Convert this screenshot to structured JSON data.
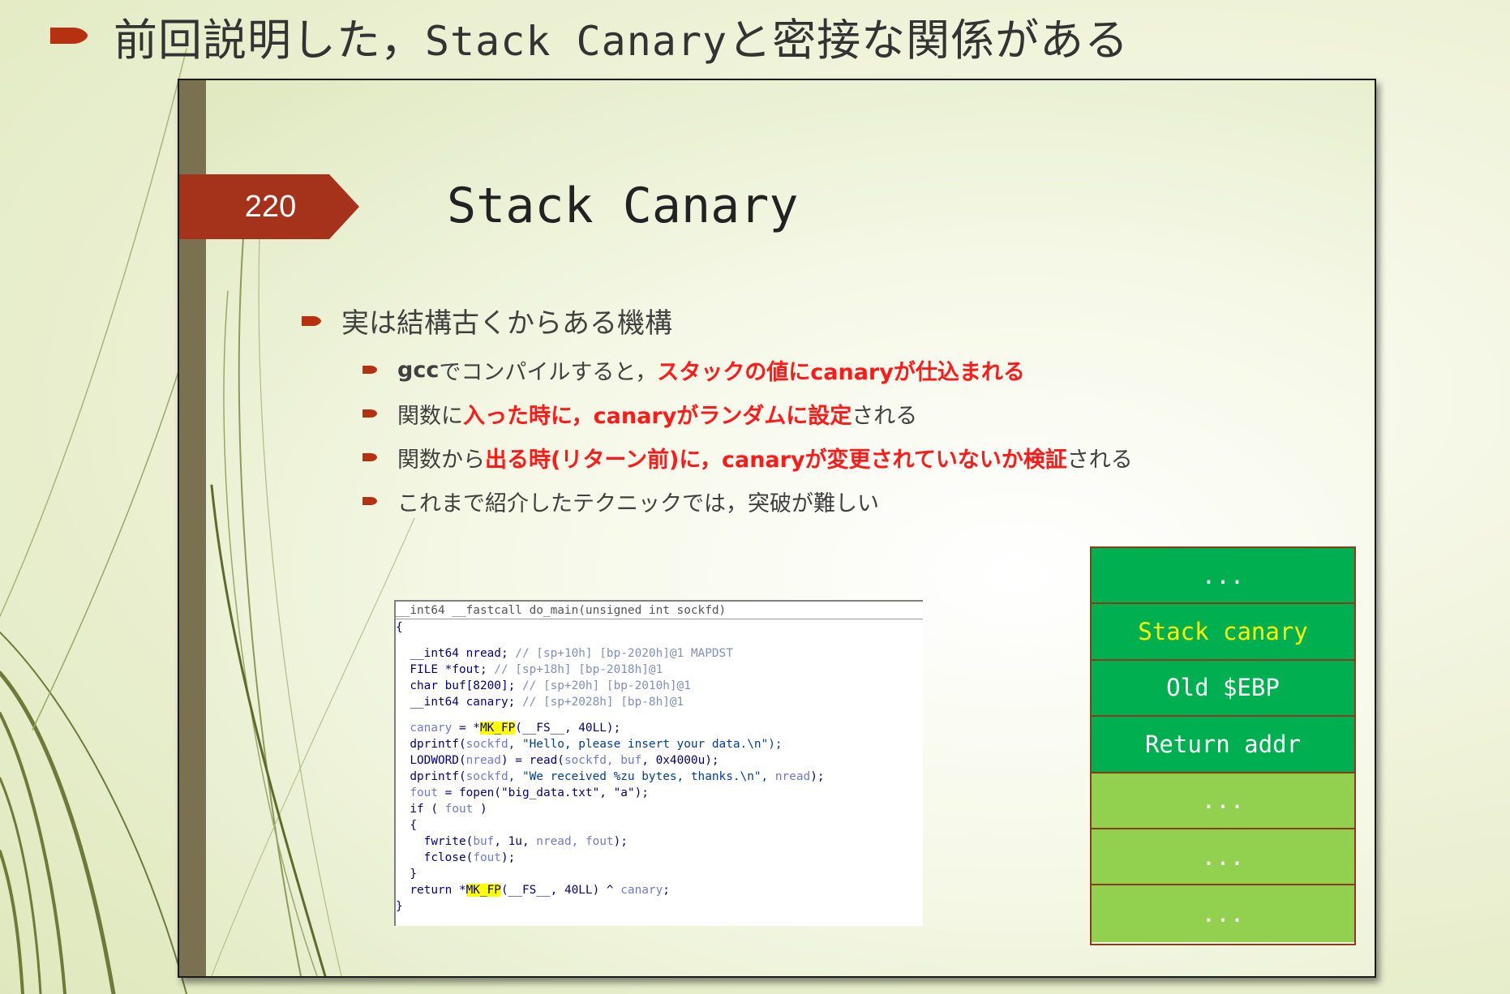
{
  "outer": {
    "title_pre": "前回説明した，",
    "title_code": "Stack Canary",
    "title_post": "と密接な関係がある"
  },
  "slide": {
    "number": "220",
    "title": "Stack Canary",
    "main_bullet": "実は結構古くからある機構",
    "sub_bullets": [
      {
        "p1": "gcc",
        "p2": "でコンパイルすると，",
        "p3": "スタックの値にcanaryが仕込まれる"
      },
      {
        "p1": "関数に",
        "p2": "入った時に，canaryがランダムに設定",
        "p3": "される"
      },
      {
        "p1": "関数から",
        "p2": "出る時(リターン前)に，canaryが変更されていないか検証",
        "p3": "される"
      },
      {
        "p1": "これまで紹介したテクニックでは，突破が難しい"
      }
    ],
    "code": {
      "header": "__int64 __fastcall do_main(unsigned int sockfd)",
      "lines": {
        "l1": "{",
        "l2a": "  __int64 nread; ",
        "l2b": "// [sp+10h] [bp-2020h]@1 MAPDST",
        "l3a": "  FILE *fout; ",
        "l3b": "// [sp+18h] [bp-2018h]@1",
        "l4a": "  char buf[8200]; ",
        "l4b": "// [sp+20h] [bp-2010h]@1",
        "l5a": "  __int64 canary; ",
        "l5b": "// [sp+2028h] [bp-8h]@1",
        "l6a": "  canary",
        "l6b": " = *",
        "l6c": "MK_FP",
        "l6d": "(__FS__, 40LL);",
        "l7a": "  dprintf(",
        "l7b": "sockfd",
        "l7c": ", \"Hello, please insert your data.\\n\");",
        "l8a": "  LODWORD(",
        "l8b": "nread",
        "l8c": ") = read(",
        "l8d": "sockfd, buf",
        "l8e": ", 0x4000u);",
        "l9a": "  dprintf(",
        "l9b": "sockfd",
        "l9c": ", \"We received %zu bytes, thanks.\\n\", ",
        "l9d": "nread",
        "l9e": ");",
        "l10a": "  fout",
        "l10b": " = fopen(\"big_data.txt\", \"a\");",
        "l11a": "  if ( ",
        "l11b": "fout",
        "l11c": " )",
        "l12": "  {",
        "l13a": "    fwrite(",
        "l13b": "buf",
        "l13c": ", 1u, ",
        "l13d": "nread, fout",
        "l13e": ");",
        "l14a": "    fclose(",
        "l14b": "fout",
        "l14c": ");",
        "l15": "  }",
        "l16a": "  return *",
        "l16b": "MK_FP",
        "l16c": "(__FS__, 40LL) ^ ",
        "l16d": "canary",
        "l16e": ";",
        "l17": "}"
      }
    },
    "stack": [
      "...",
      "Stack canary",
      "Old $EBP",
      "Return addr",
      "...",
      "...",
      "..."
    ]
  },
  "colors": {
    "accent_red": "#ff1a1a",
    "tag_red": "#a5321a",
    "stack_dark_green": "#00b050",
    "stack_light_green": "#92d050",
    "canary_yellow": "#ffff00"
  }
}
